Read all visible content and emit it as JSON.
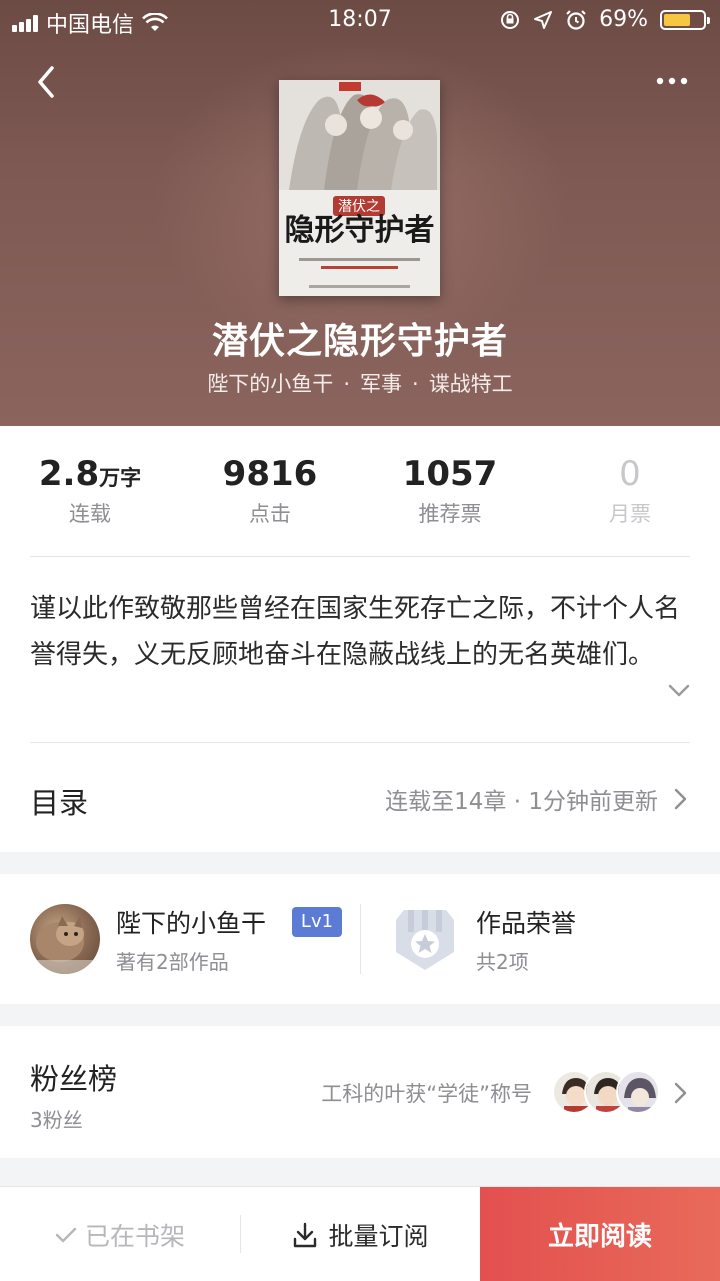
{
  "status_bar": {
    "carrier": "中国电信",
    "time": "18:07",
    "battery_percent": "69%",
    "battery_level": 0.69,
    "icons": [
      "signal-icon",
      "wifi-icon",
      "orientation-lock-icon",
      "location-icon",
      "alarm-icon",
      "battery-icon"
    ]
  },
  "nav": {
    "back_icon": "back-chevron-icon",
    "more_icon": "more-dots-icon"
  },
  "book": {
    "cover_title": "隐形守护者",
    "title": "潜伏之隐形守护者",
    "author": "陛下的小鱼干",
    "category": "军事",
    "subcategory": "谍战特工",
    "separator": "·"
  },
  "stats": [
    {
      "value": "2.8",
      "unit": "万字",
      "label": "连载"
    },
    {
      "value": "9816",
      "unit": "",
      "label": "点击"
    },
    {
      "value": "1057",
      "unit": "",
      "label": "推荐票"
    },
    {
      "value": "0",
      "unit": "",
      "label": "月票"
    }
  ],
  "intro": "谨以此作致敬那些曾经在国家生死存亡之际，不计个人名誉得失，义无反顾地奋斗在隐蔽战线上的无名英雄们。",
  "toc": {
    "title": "目录",
    "info": "连载至14章 · 1分钟前更新"
  },
  "author_card": {
    "name": "陛下的小鱼干",
    "level": "Lv1",
    "works": "著有2部作品",
    "honor_title": "作品荣誉",
    "honor_count": "共2项"
  },
  "fans": {
    "title": "粉丝榜",
    "count": "3粉丝",
    "note": "工科的叶获“学徒”称号"
  },
  "bottom_bar": {
    "shelf_label": "已在书架",
    "batch_label": "批量订阅",
    "read_label": "立即阅读"
  },
  "colors": {
    "header_bg": "#7e5953",
    "read_button": "#e3504f",
    "level_badge": "#5b7bd5",
    "battery": "#f7c744"
  }
}
